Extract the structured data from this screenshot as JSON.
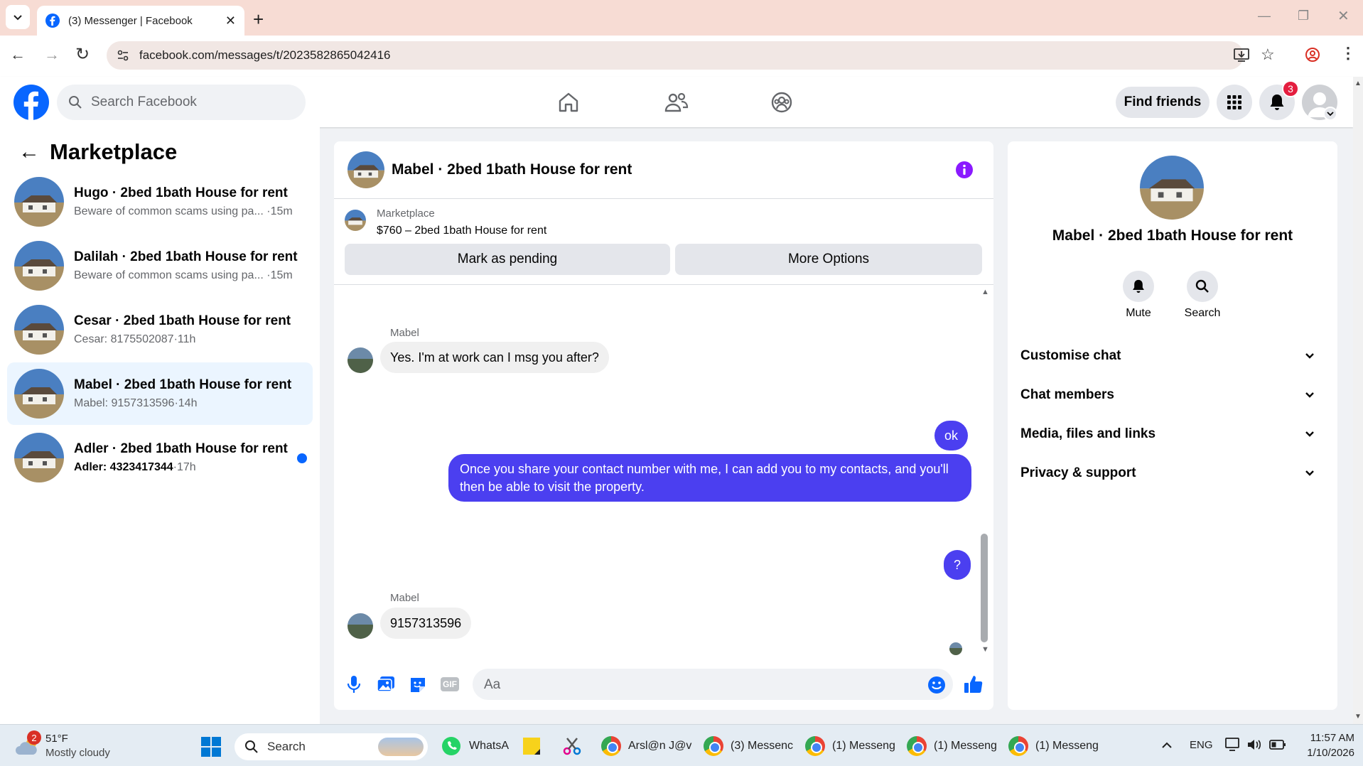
{
  "browser": {
    "tab_title": "(3) Messenger | Facebook",
    "url": "facebook.com/messages/t/2023582865042416"
  },
  "fb_header": {
    "search_placeholder": "Search Facebook",
    "find_friends": "Find friends",
    "notification_count": "3"
  },
  "sidebar": {
    "title": "Marketplace",
    "conversations": [
      {
        "title": "Hugo · 2bed 1bath House for rent",
        "preview": "Beware of common scams using pa...",
        "time": "·15m",
        "unread": false
      },
      {
        "title": "Dalilah · 2bed 1bath House for rent",
        "preview": "Beware of common scams using pa...",
        "time": "·15m",
        "unread": false
      },
      {
        "title": "Cesar · 2bed 1bath House for rent",
        "preview": "Cesar: 8175502087",
        "time": "·11h",
        "unread": false
      },
      {
        "title": "Mabel · 2bed 1bath House for rent",
        "preview": "Mabel: 9157313596",
        "time": "·14h",
        "unread": false
      },
      {
        "title": "Adler · 2bed 1bath House for rent",
        "preview": "Adler: 4323417344",
        "time": "·17h",
        "unread": true
      }
    ]
  },
  "chat": {
    "title": "Mabel · 2bed 1bath House for rent",
    "listing_source": "Marketplace",
    "listing_price_title": "$760 – 2bed 1bath House for rent",
    "mark_pending": "Mark as pending",
    "more_options": "More Options",
    "messages": [
      {
        "sender": "Mabel",
        "text": "Yes. I'm at work can I msg you after?",
        "direction": "in"
      },
      {
        "text": "ok",
        "direction": "out"
      },
      {
        "text": "Once you share your contact number with me, I can add you to my contacts, and you'll then be able to visit the property.",
        "direction": "out"
      },
      {
        "text": "?",
        "direction": "out"
      },
      {
        "sender": "Mabel",
        "text": "9157313596",
        "direction": "in"
      }
    ],
    "composer_placeholder": "Aa",
    "accent_color": "#4b3ff0"
  },
  "details": {
    "title": "Mabel · 2bed 1bath House for rent",
    "mute": "Mute",
    "search": "Search",
    "sections": [
      "Customise chat",
      "Chat members",
      "Media, files and links",
      "Privacy & support"
    ]
  },
  "taskbar": {
    "weather_temp": "51°F",
    "weather_desc": "Mostly cloudy",
    "weather_badge": "2",
    "search": "Search",
    "apps": [
      "WhatsA",
      "Arsl@n J@v",
      "(3) Messenc",
      "(1) Messeng",
      "(1) Messeng",
      "(1) Messeng"
    ],
    "lang": "ENG",
    "time": "11:57 AM",
    "date": "1/10/2026"
  }
}
